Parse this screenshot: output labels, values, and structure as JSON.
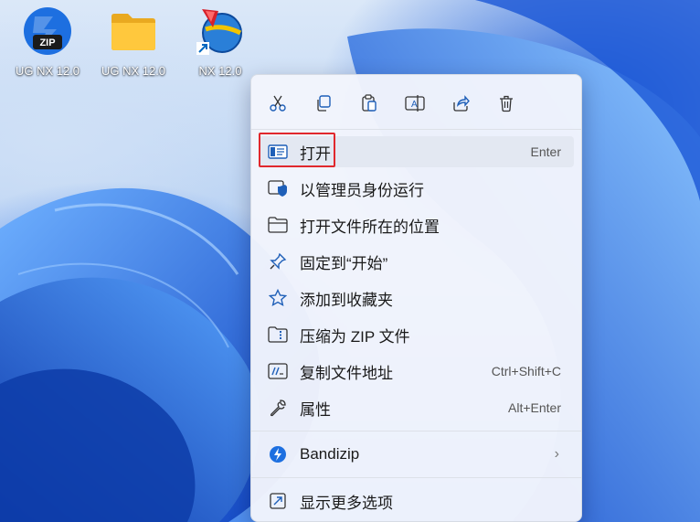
{
  "desktop": {
    "icons": [
      {
        "label": "UG NX 12.0",
        "icon": "zip-archive-icon"
      },
      {
        "label": "UG NX 12.0",
        "icon": "folder-icon"
      },
      {
        "label": "NX 12.0",
        "icon": "nx-app-shortcut-icon"
      }
    ],
    "zip_badge_text": "ZIP"
  },
  "context_menu": {
    "toolbar": [
      {
        "icon": "cut-icon"
      },
      {
        "icon": "copy-icon"
      },
      {
        "icon": "paste-icon"
      },
      {
        "icon": "rename-icon"
      },
      {
        "icon": "share-icon"
      },
      {
        "icon": "delete-icon"
      }
    ],
    "items": [
      {
        "label": "打开",
        "shortcut": "Enter",
        "icon": "open-icon",
        "highlighted": true
      },
      {
        "label": "以管理员身份运行",
        "icon": "run-as-admin-icon"
      },
      {
        "label": "打开文件所在的位置",
        "icon": "open-folder-icon"
      },
      {
        "label": "固定到“开始”",
        "icon": "pin-icon"
      },
      {
        "label": "添加到收藏夹",
        "icon": "star-icon"
      },
      {
        "label": "压缩为 ZIP 文件",
        "icon": "compress-zip-icon"
      },
      {
        "label": "复制文件地址",
        "shortcut": "Ctrl+Shift+C",
        "icon": "copy-path-icon"
      },
      {
        "label": "属性",
        "shortcut": "Alt+Enter",
        "icon": "wrench-icon"
      },
      {
        "label": "Bandizip",
        "submenu_arrow": "›",
        "icon": "bandizip-icon"
      },
      {
        "label": "显示更多选项",
        "icon": "more-options-icon"
      }
    ]
  },
  "colors": {
    "accent": "#0067c0",
    "highlight_border": "#e0282d"
  }
}
